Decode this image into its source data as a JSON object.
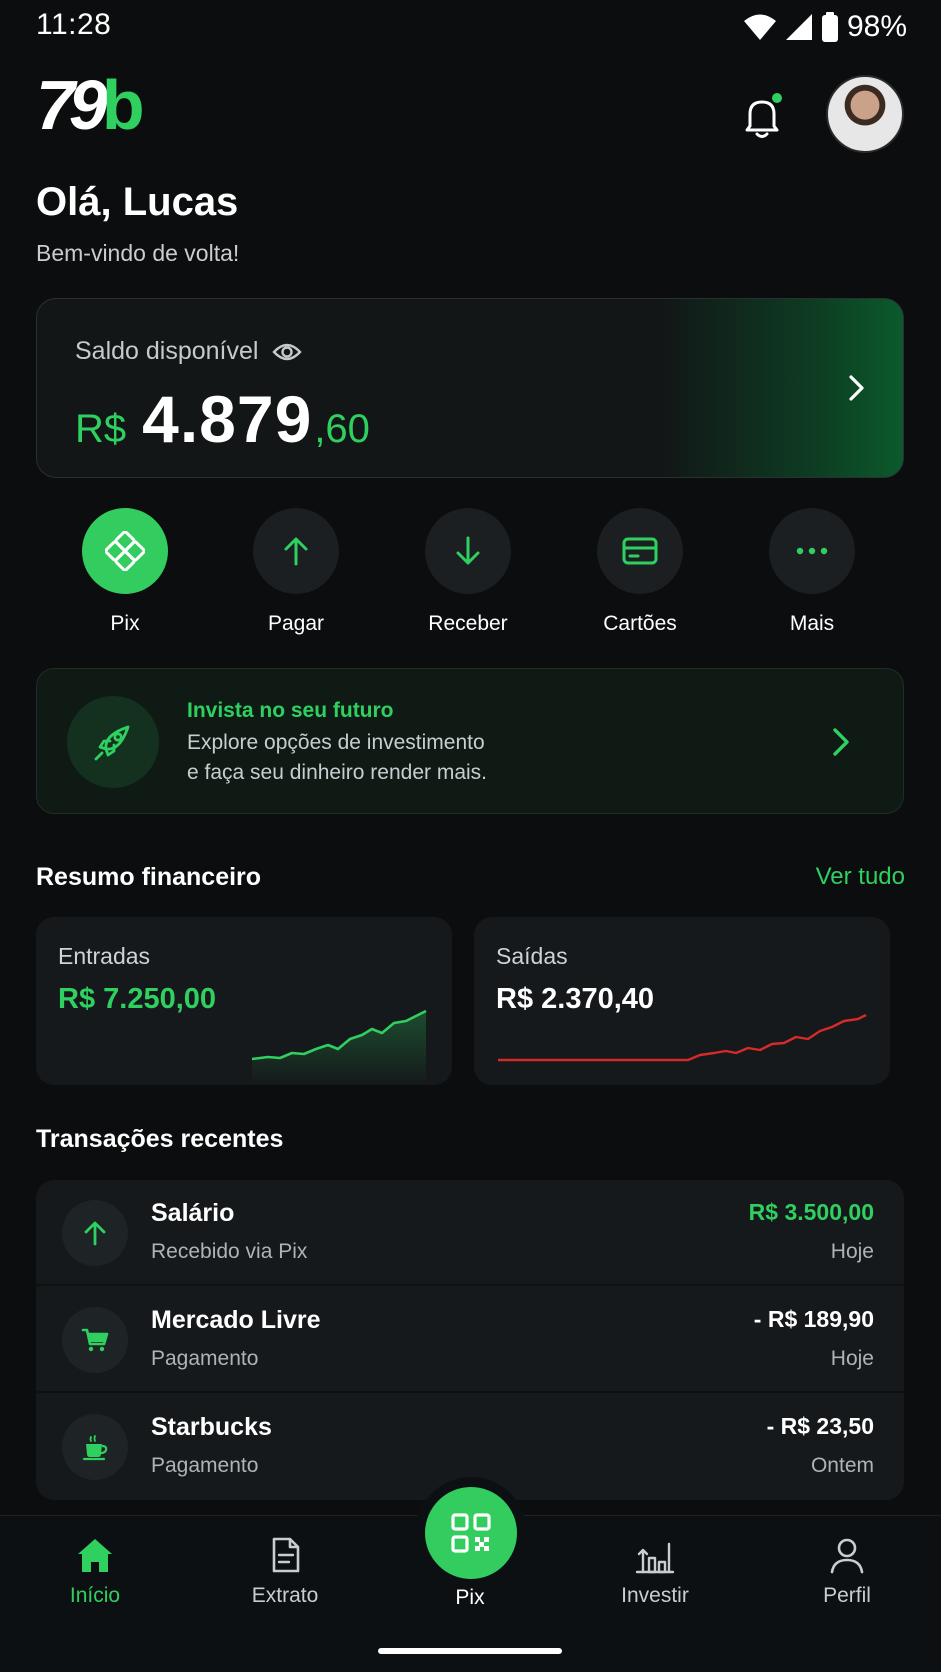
{
  "status_bar": {
    "time": "11:28",
    "battery": "98%"
  },
  "header": {
    "logo_part1": "79",
    "logo_part2": "b",
    "greeting": "Olá, Lucas",
    "subtitle": "Bem-vindo de volta!"
  },
  "balance": {
    "label": "Saldo disponível",
    "currency": "R$",
    "integer": "4.879",
    "decimal": ",60"
  },
  "quick_actions": [
    {
      "label": "Pix",
      "icon": "pix-icon"
    },
    {
      "label": "Pagar",
      "icon": "arrow-up-icon"
    },
    {
      "label": "Receber",
      "icon": "arrow-down-icon"
    },
    {
      "label": "Cartões",
      "icon": "card-icon"
    },
    {
      "label": "Mais",
      "icon": "more-icon"
    }
  ],
  "promo": {
    "title": "Invista no seu futuro",
    "line1": "Explore opções de investimento",
    "line2": "e faça seu dinheiro render mais."
  },
  "summary": {
    "title": "Resumo financeiro",
    "see_all": "Ver tudo",
    "income": {
      "label": "Entradas",
      "value": "R$ 7.250,00"
    },
    "expenses": {
      "label": "Saídas",
      "value": "R$ 2.370,40"
    }
  },
  "transactions": {
    "title": "Transações recentes",
    "items": [
      {
        "name": "Salário",
        "sub": "Recebido via Pix",
        "amount": "R$ 3.500,00",
        "date": "Hoje",
        "positive": true,
        "icon": "arrow-up-icon"
      },
      {
        "name": "Mercado Livre",
        "sub": "Pagamento",
        "amount": "- R$ 189,90",
        "date": "Hoje",
        "positive": false,
        "icon": "cart-icon"
      },
      {
        "name": "Starbucks",
        "sub": "Pagamento",
        "amount": "- R$ 23,50",
        "date": "Ontem",
        "positive": false,
        "icon": "coffee-icon"
      }
    ]
  },
  "bottom_nav": {
    "home": "Início",
    "statement": "Extrato",
    "pix": "Pix",
    "invest": "Investir",
    "profile": "Perfil"
  },
  "colors": {
    "accent": "#2fd060",
    "background": "#0b0d0e",
    "card": "#15191b",
    "expense_line": "#d62a2a"
  }
}
